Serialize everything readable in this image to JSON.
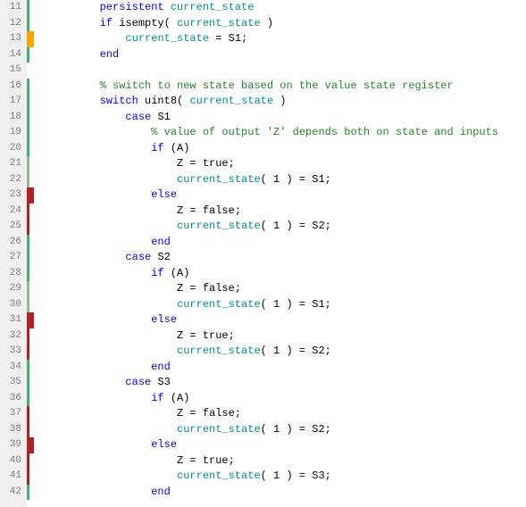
{
  "lines": [
    {
      "n": 11,
      "markers": [
        {
          "color": "#3cb371",
          "left": 0,
          "w": 3
        }
      ],
      "tokens": [
        [
          "plain",
          "        "
        ],
        [
          "kw",
          "persistent "
        ],
        [
          "var",
          "current_state"
        ]
      ]
    },
    {
      "n": 12,
      "markers": [
        {
          "color": "#3cb371",
          "left": 0,
          "w": 3
        }
      ],
      "tokens": [
        [
          "plain",
          "        "
        ],
        [
          "kw",
          "if "
        ],
        [
          "plain",
          "isempty( "
        ],
        [
          "var",
          "current_state"
        ],
        [
          "plain",
          " )"
        ]
      ]
    },
    {
      "n": 13,
      "markers": [
        {
          "color": "#ffa500",
          "left": 0,
          "w": 8
        }
      ],
      "tokens": [
        [
          "plain",
          "            "
        ],
        [
          "var",
          "current_state"
        ],
        [
          "plain",
          " = S1;"
        ]
      ]
    },
    {
      "n": 14,
      "markers": [
        {
          "color": "#3cb371",
          "left": 0,
          "w": 3
        }
      ],
      "tokens": [
        [
          "plain",
          "        "
        ],
        [
          "kw",
          "end"
        ]
      ]
    },
    {
      "n": 15,
      "markers": [],
      "tokens": [
        [
          "plain",
          ""
        ]
      ]
    },
    {
      "n": 16,
      "markers": [
        {
          "color": "#3cb371",
          "left": 0,
          "w": 3
        }
      ],
      "tokens": [
        [
          "plain",
          "        "
        ],
        [
          "cm",
          "% switch to new state based on the value state register"
        ]
      ]
    },
    {
      "n": 17,
      "markers": [
        {
          "color": "#3cb371",
          "left": 0,
          "w": 3
        }
      ],
      "tokens": [
        [
          "plain",
          "        "
        ],
        [
          "kw",
          "switch "
        ],
        [
          "plain",
          "uint8( "
        ],
        [
          "var",
          "current_state"
        ],
        [
          "plain",
          " )"
        ]
      ]
    },
    {
      "n": 18,
      "markers": [
        {
          "color": "#3cb371",
          "left": 0,
          "w": 3
        }
      ],
      "tokens": [
        [
          "plain",
          "            "
        ],
        [
          "kw",
          "case "
        ],
        [
          "plain",
          "S1"
        ]
      ]
    },
    {
      "n": 19,
      "markers": [
        {
          "color": "#3cb371",
          "left": 0,
          "w": 3
        }
      ],
      "tokens": [
        [
          "plain",
          "                "
        ],
        [
          "cm",
          "% value of output 'Z' depends both on state and inputs"
        ]
      ]
    },
    {
      "n": 20,
      "markers": [
        {
          "color": "#3cb371",
          "left": 0,
          "w": 3
        }
      ],
      "tokens": [
        [
          "plain",
          "                "
        ],
        [
          "kw",
          "if "
        ],
        [
          "plain",
          "(A)"
        ]
      ]
    },
    {
      "n": 21,
      "markers": [
        {
          "color": "#8fbc8f",
          "left": 0,
          "w": 3
        }
      ],
      "tokens": [
        [
          "plain",
          "                    Z = true;"
        ]
      ]
    },
    {
      "n": 22,
      "markers": [
        {
          "color": "#8fbc8f",
          "left": 0,
          "w": 3
        }
      ],
      "tokens": [
        [
          "plain",
          "                    "
        ],
        [
          "var",
          "current_state"
        ],
        [
          "plain",
          "( 1 ) = S1;"
        ]
      ]
    },
    {
      "n": 23,
      "markers": [
        {
          "color": "#b22222",
          "left": 0,
          "w": 8
        }
      ],
      "tokens": [
        [
          "plain",
          "                "
        ],
        [
          "kw",
          "else"
        ]
      ]
    },
    {
      "n": 24,
      "markers": [
        {
          "color": "#b22222",
          "left": 0,
          "w": 3
        }
      ],
      "tokens": [
        [
          "plain",
          "                    Z = false;"
        ]
      ]
    },
    {
      "n": 25,
      "markers": [
        {
          "color": "#b22222",
          "left": 0,
          "w": 3
        }
      ],
      "tokens": [
        [
          "plain",
          "                    "
        ],
        [
          "var",
          "current_state"
        ],
        [
          "plain",
          "( 1 ) = S2;"
        ]
      ]
    },
    {
      "n": 26,
      "markers": [
        {
          "color": "#3cb371",
          "left": 0,
          "w": 3
        }
      ],
      "tokens": [
        [
          "plain",
          "                "
        ],
        [
          "kw",
          "end"
        ]
      ]
    },
    {
      "n": 27,
      "markers": [
        {
          "color": "#3cb371",
          "left": 0,
          "w": 3
        }
      ],
      "tokens": [
        [
          "plain",
          "            "
        ],
        [
          "kw",
          "case "
        ],
        [
          "plain",
          "S2"
        ]
      ]
    },
    {
      "n": 28,
      "markers": [
        {
          "color": "#3cb371",
          "left": 0,
          "w": 3
        }
      ],
      "tokens": [
        [
          "plain",
          "                "
        ],
        [
          "kw",
          "if "
        ],
        [
          "plain",
          "(A)"
        ]
      ]
    },
    {
      "n": 29,
      "markers": [
        {
          "color": "#8fbc8f",
          "left": 0,
          "w": 3
        }
      ],
      "tokens": [
        [
          "plain",
          "                    Z = false;"
        ]
      ]
    },
    {
      "n": 30,
      "markers": [
        {
          "color": "#8fbc8f",
          "left": 0,
          "w": 3
        }
      ],
      "tokens": [
        [
          "plain",
          "                    "
        ],
        [
          "var",
          "current_state"
        ],
        [
          "plain",
          "( 1 ) = S1;"
        ]
      ]
    },
    {
      "n": 31,
      "markers": [
        {
          "color": "#b22222",
          "left": 0,
          "w": 8
        }
      ],
      "tokens": [
        [
          "plain",
          "                "
        ],
        [
          "kw",
          "else"
        ]
      ]
    },
    {
      "n": 32,
      "markers": [
        {
          "color": "#b22222",
          "left": 0,
          "w": 3
        }
      ],
      "tokens": [
        [
          "plain",
          "                    Z = true;"
        ]
      ]
    },
    {
      "n": 33,
      "markers": [
        {
          "color": "#b22222",
          "left": 0,
          "w": 3
        }
      ],
      "tokens": [
        [
          "plain",
          "                    "
        ],
        [
          "var",
          "current_state"
        ],
        [
          "plain",
          "( 1 ) = S2;"
        ]
      ]
    },
    {
      "n": 34,
      "markers": [
        {
          "color": "#3cb371",
          "left": 0,
          "w": 3
        }
      ],
      "tokens": [
        [
          "plain",
          "                "
        ],
        [
          "kw",
          "end"
        ]
      ]
    },
    {
      "n": 35,
      "markers": [
        {
          "color": "#3cb371",
          "left": 0,
          "w": 3
        }
      ],
      "tokens": [
        [
          "plain",
          "            "
        ],
        [
          "kw",
          "case "
        ],
        [
          "plain",
          "S3"
        ]
      ]
    },
    {
      "n": 36,
      "markers": [
        {
          "color": "#3cb371",
          "left": 0,
          "w": 3
        }
      ],
      "tokens": [
        [
          "plain",
          "                "
        ],
        [
          "kw",
          "if "
        ],
        [
          "plain",
          "(A)"
        ]
      ]
    },
    {
      "n": 37,
      "markers": [
        {
          "color": "#b22222",
          "left": 0,
          "w": 3
        }
      ],
      "tokens": [
        [
          "plain",
          "                    Z = false;"
        ]
      ]
    },
    {
      "n": 38,
      "markers": [
        {
          "color": "#b22222",
          "left": 0,
          "w": 3
        }
      ],
      "tokens": [
        [
          "plain",
          "                    "
        ],
        [
          "var",
          "current_state"
        ],
        [
          "plain",
          "( 1 ) = S2;"
        ]
      ]
    },
    {
      "n": 39,
      "markers": [
        {
          "color": "#b22222",
          "left": 0,
          "w": 8
        }
      ],
      "tokens": [
        [
          "plain",
          "                "
        ],
        [
          "kw",
          "else"
        ]
      ]
    },
    {
      "n": 40,
      "markers": [
        {
          "color": "#b22222",
          "left": 0,
          "w": 3
        }
      ],
      "tokens": [
        [
          "plain",
          "                    Z = true;"
        ]
      ]
    },
    {
      "n": 41,
      "markers": [
        {
          "color": "#b22222",
          "left": 0,
          "w": 3
        }
      ],
      "tokens": [
        [
          "plain",
          "                    "
        ],
        [
          "var",
          "current_state"
        ],
        [
          "plain",
          "( 1 ) = S3;"
        ]
      ]
    },
    {
      "n": 42,
      "markers": [
        {
          "color": "#3cb371",
          "left": 0,
          "w": 3
        }
      ],
      "tokens": [
        [
          "plain",
          "                "
        ],
        [
          "kw",
          "end"
        ]
      ]
    }
  ]
}
